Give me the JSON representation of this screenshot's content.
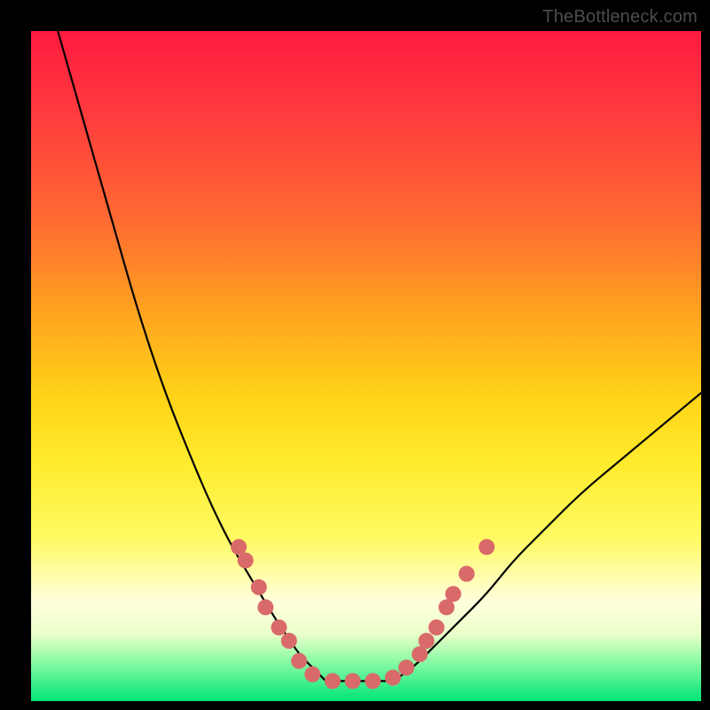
{
  "watermark": "TheBottleneck.com",
  "chart_data": {
    "type": "line",
    "title": "",
    "xlabel": "",
    "ylabel": "",
    "xlim": [
      0,
      100
    ],
    "ylim": [
      0,
      100
    ],
    "grid": false,
    "legend": false,
    "background": "rainbow-gradient",
    "series": [
      {
        "name": "left-curve",
        "x": [
          4,
          8,
          12,
          16,
          20,
          24,
          27,
          30,
          33,
          36,
          38,
          40,
          42,
          44
        ],
        "y": [
          100,
          86,
          72,
          58,
          46,
          36,
          29,
          23,
          18,
          13,
          10,
          7,
          5,
          3
        ]
      },
      {
        "name": "right-curve",
        "x": [
          54,
          57,
          60,
          64,
          68,
          72,
          76,
          82,
          88,
          94,
          100
        ],
        "y": [
          3,
          5,
          8,
          12,
          16,
          21,
          25,
          31,
          36,
          41,
          46
        ]
      }
    ],
    "flat_bottom": {
      "x_start": 44,
      "x_end": 54,
      "y": 3
    },
    "markers": [
      {
        "x": 31,
        "y": 23
      },
      {
        "x": 32,
        "y": 21
      },
      {
        "x": 34,
        "y": 17
      },
      {
        "x": 35,
        "y": 14
      },
      {
        "x": 37,
        "y": 11
      },
      {
        "x": 38.5,
        "y": 9
      },
      {
        "x": 40,
        "y": 6
      },
      {
        "x": 42,
        "y": 4
      },
      {
        "x": 45,
        "y": 3
      },
      {
        "x": 48,
        "y": 3
      },
      {
        "x": 51,
        "y": 3
      },
      {
        "x": 54,
        "y": 3.5
      },
      {
        "x": 56,
        "y": 5
      },
      {
        "x": 58,
        "y": 7
      },
      {
        "x": 59,
        "y": 9
      },
      {
        "x": 60.5,
        "y": 11
      },
      {
        "x": 62,
        "y": 14
      },
      {
        "x": 63,
        "y": 16
      },
      {
        "x": 65,
        "y": 19
      },
      {
        "x": 68,
        "y": 23
      }
    ],
    "marker_radius": 9
  }
}
